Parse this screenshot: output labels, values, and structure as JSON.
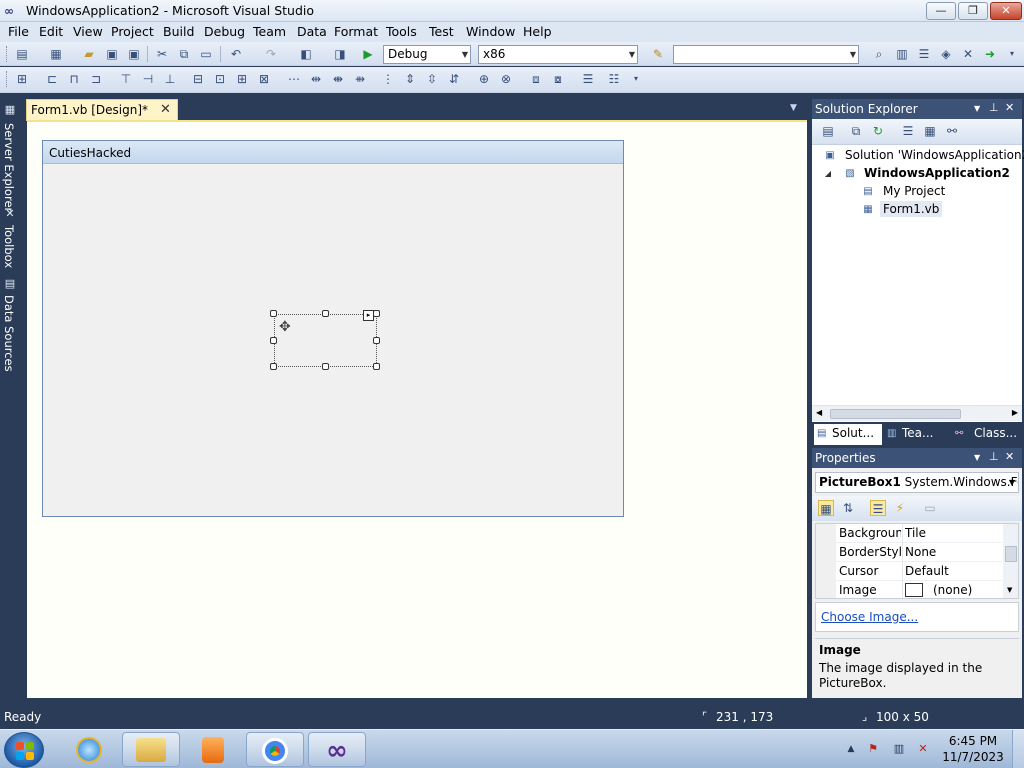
{
  "window": {
    "title": "WindowsApplication2 - Microsoft Visual Studio",
    "min_glyph": "—",
    "max_glyph": "❐",
    "close_glyph": "✕"
  },
  "menu": [
    "File",
    "Edit",
    "View",
    "Project",
    "Build",
    "Debug",
    "Team",
    "Data",
    "Format",
    "Tools",
    "Test",
    "Window",
    "Help"
  ],
  "toolbar": {
    "config": "Debug",
    "platform": "x86",
    "search_value": ""
  },
  "left_tabs": [
    "Server Explorer",
    "Toolbox",
    "Data Sources"
  ],
  "document": {
    "tab_label": "Form1.vb [Design]*",
    "close_glyph": "✕",
    "form_caption": "CutiesHacked"
  },
  "solution_explorer": {
    "title": "Solution Explorer",
    "items": [
      {
        "label": "Solution 'WindowsApplication2'"
      },
      {
        "label": "WindowsApplication2"
      },
      {
        "label": "My Project"
      },
      {
        "label": "Form1.vb"
      }
    ],
    "tabs": [
      "Solut...",
      "Tea...",
      "Class..."
    ]
  },
  "properties": {
    "title": "Properties",
    "object_name": "PictureBox1",
    "object_type": "System.Windows.For",
    "rows": [
      {
        "name": "Background",
        "value": "Tile"
      },
      {
        "name": "BorderStyle",
        "value": "None"
      },
      {
        "name": "Cursor",
        "value": "Default"
      },
      {
        "name": "Image",
        "value": "(none)"
      }
    ],
    "command_link": "Choose Image...",
    "desc_title": "Image",
    "desc_text": "The image displayed in the PictureBox."
  },
  "status": {
    "text": "Ready",
    "position": "231 , 173",
    "size": "100 x 50"
  },
  "taskbar": {
    "time": "6:45 PM",
    "date": "11/7/2023"
  },
  "colors": {
    "vs_chrome": "#2b3c59",
    "panel_header": "#3d5277",
    "designer_bg": "#fffff9",
    "link": "#1a4dbd"
  }
}
